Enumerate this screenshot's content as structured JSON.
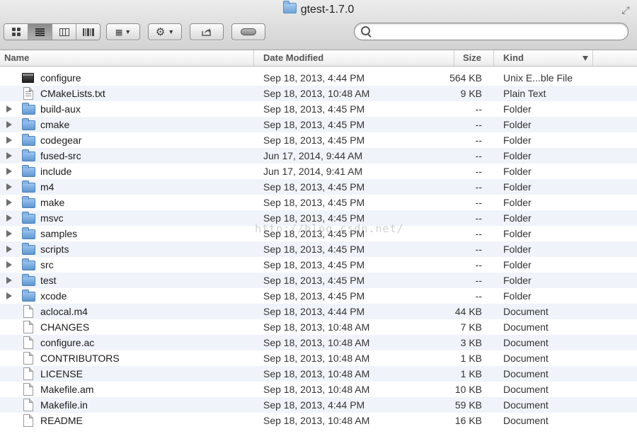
{
  "window": {
    "title": "gtest-1.7.0"
  },
  "toolbar": {
    "view_icons": "icon-view-icon",
    "view_list": "list-view-icon",
    "view_columns": "column-view-icon",
    "view_coverflow": "coverflow-view-icon",
    "arrange_icon": "arrange-icon",
    "action_icon": "gear-icon",
    "share_icon": "share-icon",
    "tag_icon": "tag-icon",
    "search_placeholder": ""
  },
  "columns": {
    "name": "Name",
    "date": "Date Modified",
    "size": "Size",
    "kind": "Kind"
  },
  "files": [
    {
      "name": "configure",
      "date": "Sep 18, 2013, 4:44 PM",
      "size": "564 KB",
      "kind": "Unix E...ble File",
      "icon": "exec",
      "folder": false
    },
    {
      "name": "CMakeLists.txt",
      "date": "Sep 18, 2013, 10:48 AM",
      "size": "9 KB",
      "kind": "Plain Text",
      "icon": "txt",
      "folder": false
    },
    {
      "name": "build-aux",
      "date": "Sep 18, 2013, 4:45 PM",
      "size": "--",
      "kind": "Folder",
      "icon": "folder",
      "folder": true
    },
    {
      "name": "cmake",
      "date": "Sep 18, 2013, 4:45 PM",
      "size": "--",
      "kind": "Folder",
      "icon": "folder",
      "folder": true
    },
    {
      "name": "codegear",
      "date": "Sep 18, 2013, 4:45 PM",
      "size": "--",
      "kind": "Folder",
      "icon": "folder",
      "folder": true
    },
    {
      "name": "fused-src",
      "date": "Jun 17, 2014, 9:44 AM",
      "size": "--",
      "kind": "Folder",
      "icon": "folder",
      "folder": true
    },
    {
      "name": "include",
      "date": "Jun 17, 2014, 9:41 AM",
      "size": "--",
      "kind": "Folder",
      "icon": "folder",
      "folder": true
    },
    {
      "name": "m4",
      "date": "Sep 18, 2013, 4:45 PM",
      "size": "--",
      "kind": "Folder",
      "icon": "folder",
      "folder": true
    },
    {
      "name": "make",
      "date": "Sep 18, 2013, 4:45 PM",
      "size": "--",
      "kind": "Folder",
      "icon": "folder",
      "folder": true
    },
    {
      "name": "msvc",
      "date": "Sep 18, 2013, 4:45 PM",
      "size": "--",
      "kind": "Folder",
      "icon": "folder",
      "folder": true
    },
    {
      "name": "samples",
      "date": "Sep 18, 2013, 4:45 PM",
      "size": "--",
      "kind": "Folder",
      "icon": "folder",
      "folder": true
    },
    {
      "name": "scripts",
      "date": "Sep 18, 2013, 4:45 PM",
      "size": "--",
      "kind": "Folder",
      "icon": "folder",
      "folder": true
    },
    {
      "name": "src",
      "date": "Sep 18, 2013, 4:45 PM",
      "size": "--",
      "kind": "Folder",
      "icon": "folder",
      "folder": true
    },
    {
      "name": "test",
      "date": "Sep 18, 2013, 4:45 PM",
      "size": "--",
      "kind": "Folder",
      "icon": "folder",
      "folder": true
    },
    {
      "name": "xcode",
      "date": "Sep 18, 2013, 4:45 PM",
      "size": "--",
      "kind": "Folder",
      "icon": "folder",
      "folder": true
    },
    {
      "name": "aclocal.m4",
      "date": "Sep 18, 2013, 4:44 PM",
      "size": "44 KB",
      "kind": "Document",
      "icon": "doc",
      "folder": false
    },
    {
      "name": "CHANGES",
      "date": "Sep 18, 2013, 10:48 AM",
      "size": "7 KB",
      "kind": "Document",
      "icon": "doc",
      "folder": false
    },
    {
      "name": "configure.ac",
      "date": "Sep 18, 2013, 10:48 AM",
      "size": "3 KB",
      "kind": "Document",
      "icon": "doc",
      "folder": false
    },
    {
      "name": "CONTRIBUTORS",
      "date": "Sep 18, 2013, 10:48 AM",
      "size": "1 KB",
      "kind": "Document",
      "icon": "doc",
      "folder": false
    },
    {
      "name": "LICENSE",
      "date": "Sep 18, 2013, 10:48 AM",
      "size": "1 KB",
      "kind": "Document",
      "icon": "doc",
      "folder": false
    },
    {
      "name": "Makefile.am",
      "date": "Sep 18, 2013, 10:48 AM",
      "size": "10 KB",
      "kind": "Document",
      "icon": "doc",
      "folder": false
    },
    {
      "name": "Makefile.in",
      "date": "Sep 18, 2013, 4:44 PM",
      "size": "59 KB",
      "kind": "Document",
      "icon": "doc",
      "folder": false
    },
    {
      "name": "README",
      "date": "Sep 18, 2013, 10:48 AM",
      "size": "16 KB",
      "kind": "Document",
      "icon": "doc",
      "folder": false
    }
  ],
  "watermark": "http://blog.csdn.net/"
}
